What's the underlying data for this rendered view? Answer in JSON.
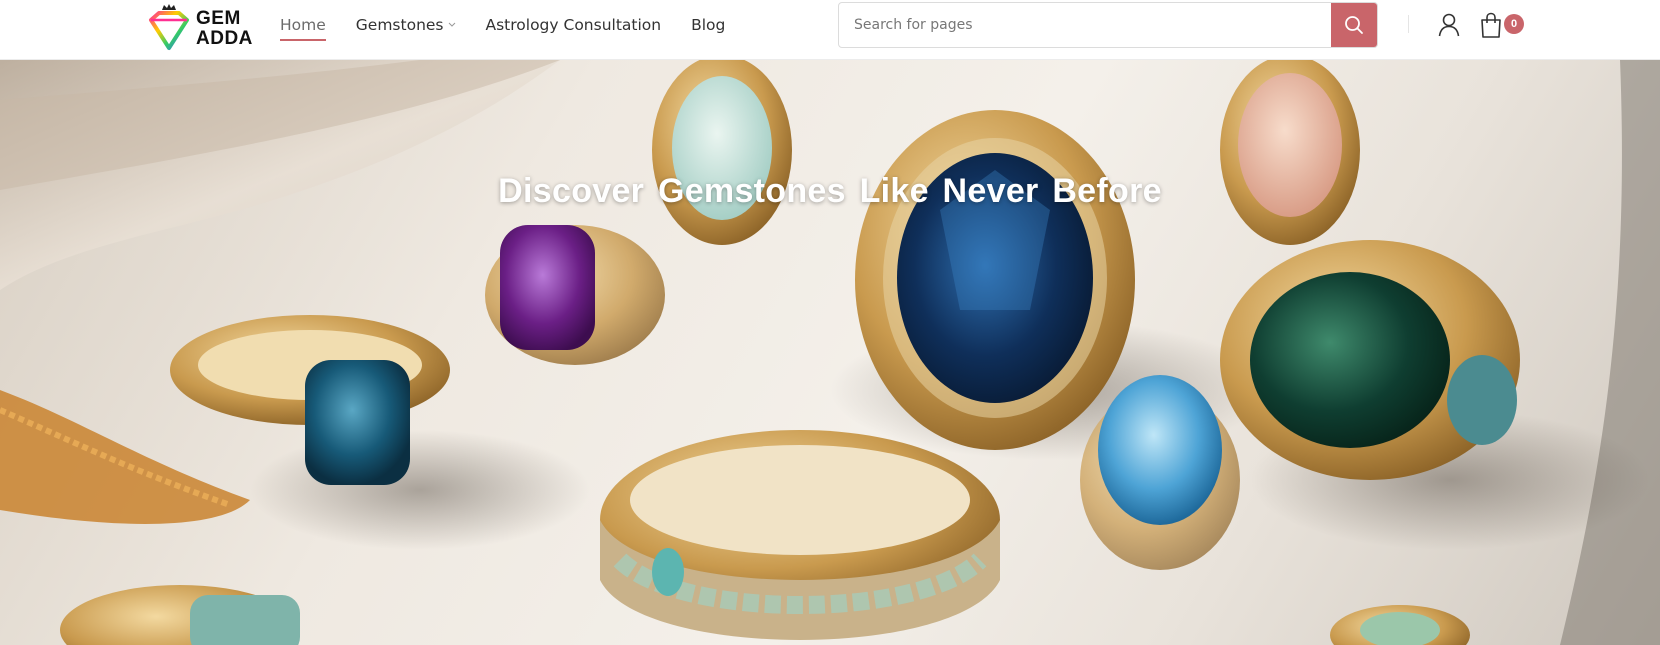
{
  "brand": {
    "name_line1": "GEM",
    "name_line2": "ADDA"
  },
  "nav": {
    "items": [
      {
        "label": "Home",
        "active": true
      },
      {
        "label": "Gemstones",
        "has_dropdown": true
      },
      {
        "label": "Astrology Consultation"
      },
      {
        "label": "Blog"
      }
    ]
  },
  "search": {
    "placeholder": "Search for pages",
    "value": ""
  },
  "cart": {
    "count": "0"
  },
  "hero": {
    "title": "Discover Gemstones Like Never Before"
  },
  "colors": {
    "accent": "#c9656a",
    "header_bg": "#ffffff",
    "hero_text": "#ffffff"
  },
  "icons": {
    "search": "search-icon",
    "account": "user-icon",
    "cart": "shopping-bag-icon",
    "dropdown": "chevron-down-icon",
    "logo": "diamond-crown-logo"
  }
}
